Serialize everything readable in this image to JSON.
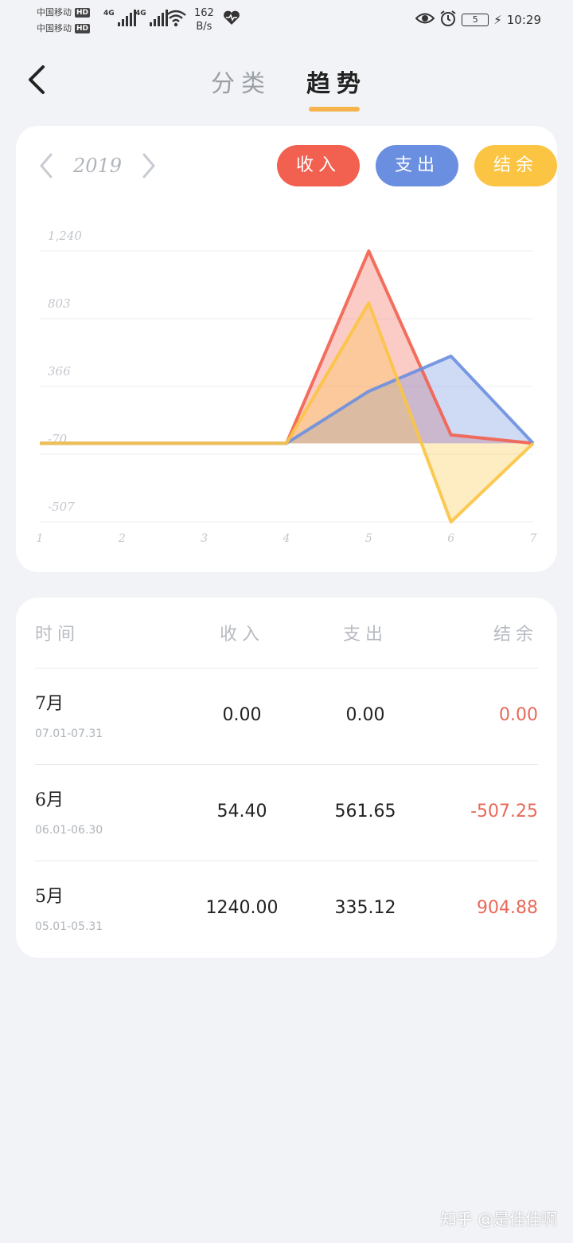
{
  "status_bar": {
    "carrier1": "中国移动",
    "carrier2": "中国移动",
    "hd": "HD",
    "network": "4G",
    "speed_value": "162",
    "speed_unit": "B/s",
    "battery": "5",
    "time": "10:29"
  },
  "header": {
    "tabs": [
      {
        "label": "分类"
      },
      {
        "label": "趋势"
      }
    ]
  },
  "chart_card": {
    "year": "2019",
    "filters": {
      "income": "收入",
      "expense": "支出",
      "balance": "结余"
    }
  },
  "colors": {
    "income": "#f2604f",
    "expense": "#6b8fe0",
    "balance": "#fbc443",
    "tab_indicator": "#f6b34c"
  },
  "chart_data": {
    "type": "area",
    "x": [
      1,
      2,
      3,
      4,
      5,
      6,
      7
    ],
    "tick_labels_x": [
      "1",
      "2",
      "3",
      "4",
      "5",
      "6",
      "7"
    ],
    "tick_labels_y": [
      "1,240",
      "803",
      "366",
      "-70",
      "-507"
    ],
    "y_ticks": [
      1240,
      803,
      366,
      -70,
      -507
    ],
    "ylim": [
      -507,
      1240
    ],
    "grid": true,
    "series": [
      {
        "key": "income",
        "values": [
          0,
          0,
          0,
          0,
          1240.0,
          54.4,
          0
        ]
      },
      {
        "key": "expense",
        "values": [
          0,
          0,
          0,
          0,
          335.12,
          561.65,
          0
        ]
      },
      {
        "key": "balance",
        "values": [
          0,
          0,
          0,
          0,
          904.88,
          -507.25,
          0
        ]
      }
    ]
  },
  "table": {
    "headers": {
      "time": "时间",
      "income": "收入",
      "expense": "支出",
      "balance": "结余"
    },
    "rows": [
      {
        "month": "7月",
        "range": "07.01-07.31",
        "income": "0.00",
        "expense": "0.00",
        "balance": "0.00"
      },
      {
        "month": "6月",
        "range": "06.01-06.30",
        "income": "54.40",
        "expense": "561.65",
        "balance": "-507.25"
      },
      {
        "month": "5月",
        "range": "05.01-05.31",
        "income": "1240.00",
        "expense": "335.12",
        "balance": "904.88"
      }
    ]
  },
  "watermark": "知乎 @是佳佳啊"
}
